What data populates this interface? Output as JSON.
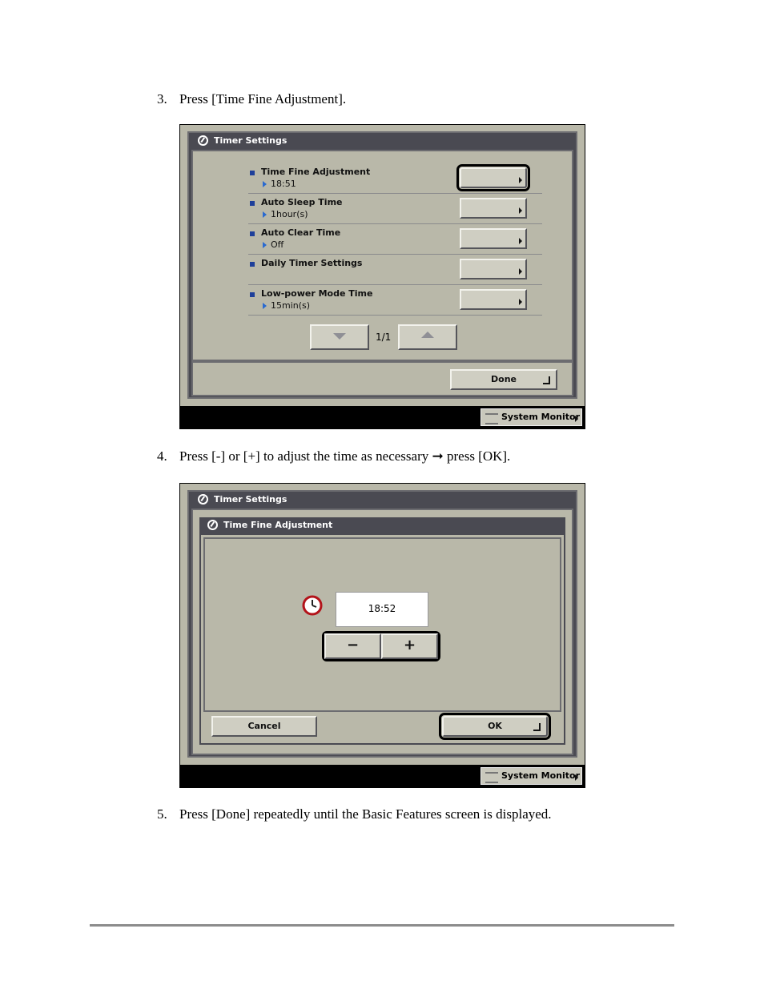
{
  "steps": [
    {
      "num": "3.",
      "text": "Press [Time Fine Adjustment]."
    },
    {
      "num": "4.",
      "text": "Press [-] or [+] to adjust the time as necessary ➞ press [OK]."
    },
    {
      "num": "5.",
      "text": "Press [Done] repeatedly until the Basic Features screen is displayed."
    }
  ],
  "screen1": {
    "title": "Timer Settings",
    "rows": [
      {
        "label": "Time Fine Adjustment",
        "value": "18:51"
      },
      {
        "label": "Auto Sleep Time",
        "value": "1hour(s)"
      },
      {
        "label": "Auto Clear Time",
        "value": "Off"
      },
      {
        "label": "Daily Timer Settings",
        "value": ""
      },
      {
        "label": "Low-power Mode Time",
        "value": "15min(s)"
      }
    ],
    "page_indicator": "1/1",
    "done_label": "Done",
    "system_monitor": "System Monitor"
  },
  "screen2": {
    "title": "Timer Settings",
    "subtitle": "Time Fine Adjustment",
    "time_value": "18:52",
    "minus_label": "−",
    "plus_label": "+",
    "cancel_label": "Cancel",
    "ok_label": "OK",
    "system_monitor": "System Monitor"
  },
  "colors": {
    "screen_bg": "#b9b8a9",
    "titlebar": "#4a4a52",
    "bullet": "#1e3f9a"
  }
}
